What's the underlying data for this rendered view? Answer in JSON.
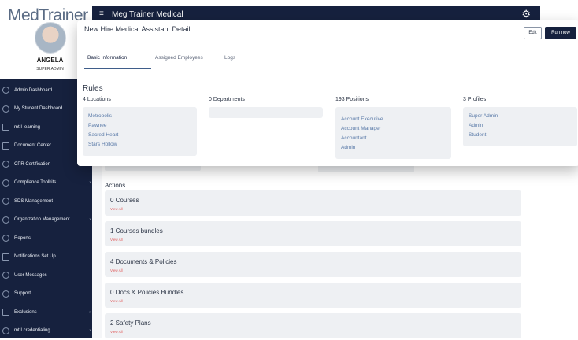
{
  "brand": {
    "logo_text": "MedTrainer",
    "primary_color": "#16213e",
    "link_color": "#e05a5a"
  },
  "user": {
    "name": "ANGELA",
    "role": "SUPER ADMIN"
  },
  "sidebar": {
    "items": [
      {
        "label": "Admin Dashboard",
        "icon": "dashboard-icon",
        "arrow": ""
      },
      {
        "label": "My Student Dashboard",
        "icon": "student-icon",
        "arrow": ""
      },
      {
        "label": "mt I learning",
        "icon": "laptop-icon",
        "arrow": ""
      },
      {
        "label": "Document Center",
        "icon": "document-icon",
        "arrow": ""
      },
      {
        "label": "CPR Certification",
        "icon": "heart-icon",
        "arrow": ""
      },
      {
        "label": "Compliance Toolkits",
        "icon": "toolkit-icon",
        "arrow": "›"
      },
      {
        "label": "SDS Management",
        "icon": "hazard-icon",
        "arrow": ""
      },
      {
        "label": "Organization Management",
        "icon": "organization-icon",
        "arrow": "›"
      },
      {
        "label": "Reports",
        "icon": "reports-icon",
        "arrow": ""
      },
      {
        "label": "Notifications Set Up",
        "icon": "notification-icon",
        "arrow": ""
      },
      {
        "label": "User Messages",
        "icon": "message-icon",
        "arrow": ""
      },
      {
        "label": "Support",
        "icon": "support-icon",
        "arrow": ""
      },
      {
        "label": "Exclusions",
        "icon": "exclusion-icon",
        "arrow": "›"
      },
      {
        "label": "mt I credentialing",
        "icon": "credential-icon",
        "arrow": "›"
      }
    ]
  },
  "topbar": {
    "menu_icon": "≡",
    "title": "Meg Trainer Medical",
    "settings_icon": "⚙"
  },
  "panel": {
    "title": "New Hire Medical Assistant Detail",
    "edit_label": "Edit",
    "run_label": "Run now",
    "tabs": [
      "Basic Information",
      "Assigned Employees",
      "Logs"
    ],
    "rules_title": "Rules",
    "columns": [
      {
        "count": "4",
        "label": "Locations",
        "items": [
          "Metropolis",
          "Pawnee",
          "Sacred Heart",
          "Stars Hollow"
        ]
      },
      {
        "count": "0",
        "label": "Departments",
        "items": []
      },
      {
        "count": "193",
        "label": "Positions",
        "items": [
          "Account Executive",
          "Account Manager",
          "Accountant",
          "Admin"
        ]
      },
      {
        "count": "3",
        "label": "Profiles",
        "items": [
          "Super Admin",
          "Admin",
          "Student"
        ]
      }
    ]
  },
  "actions": {
    "title": "Actions",
    "items": [
      {
        "title": "0 Courses",
        "link": "View All"
      },
      {
        "title": "1 Courses bundles",
        "link": "View All"
      },
      {
        "title": "4 Documents & Policies",
        "link": "View All"
      },
      {
        "title": "0 Docs & Policies Bundles",
        "link": "View All"
      },
      {
        "title": "2 Safety Plans",
        "link": "View All"
      }
    ]
  }
}
